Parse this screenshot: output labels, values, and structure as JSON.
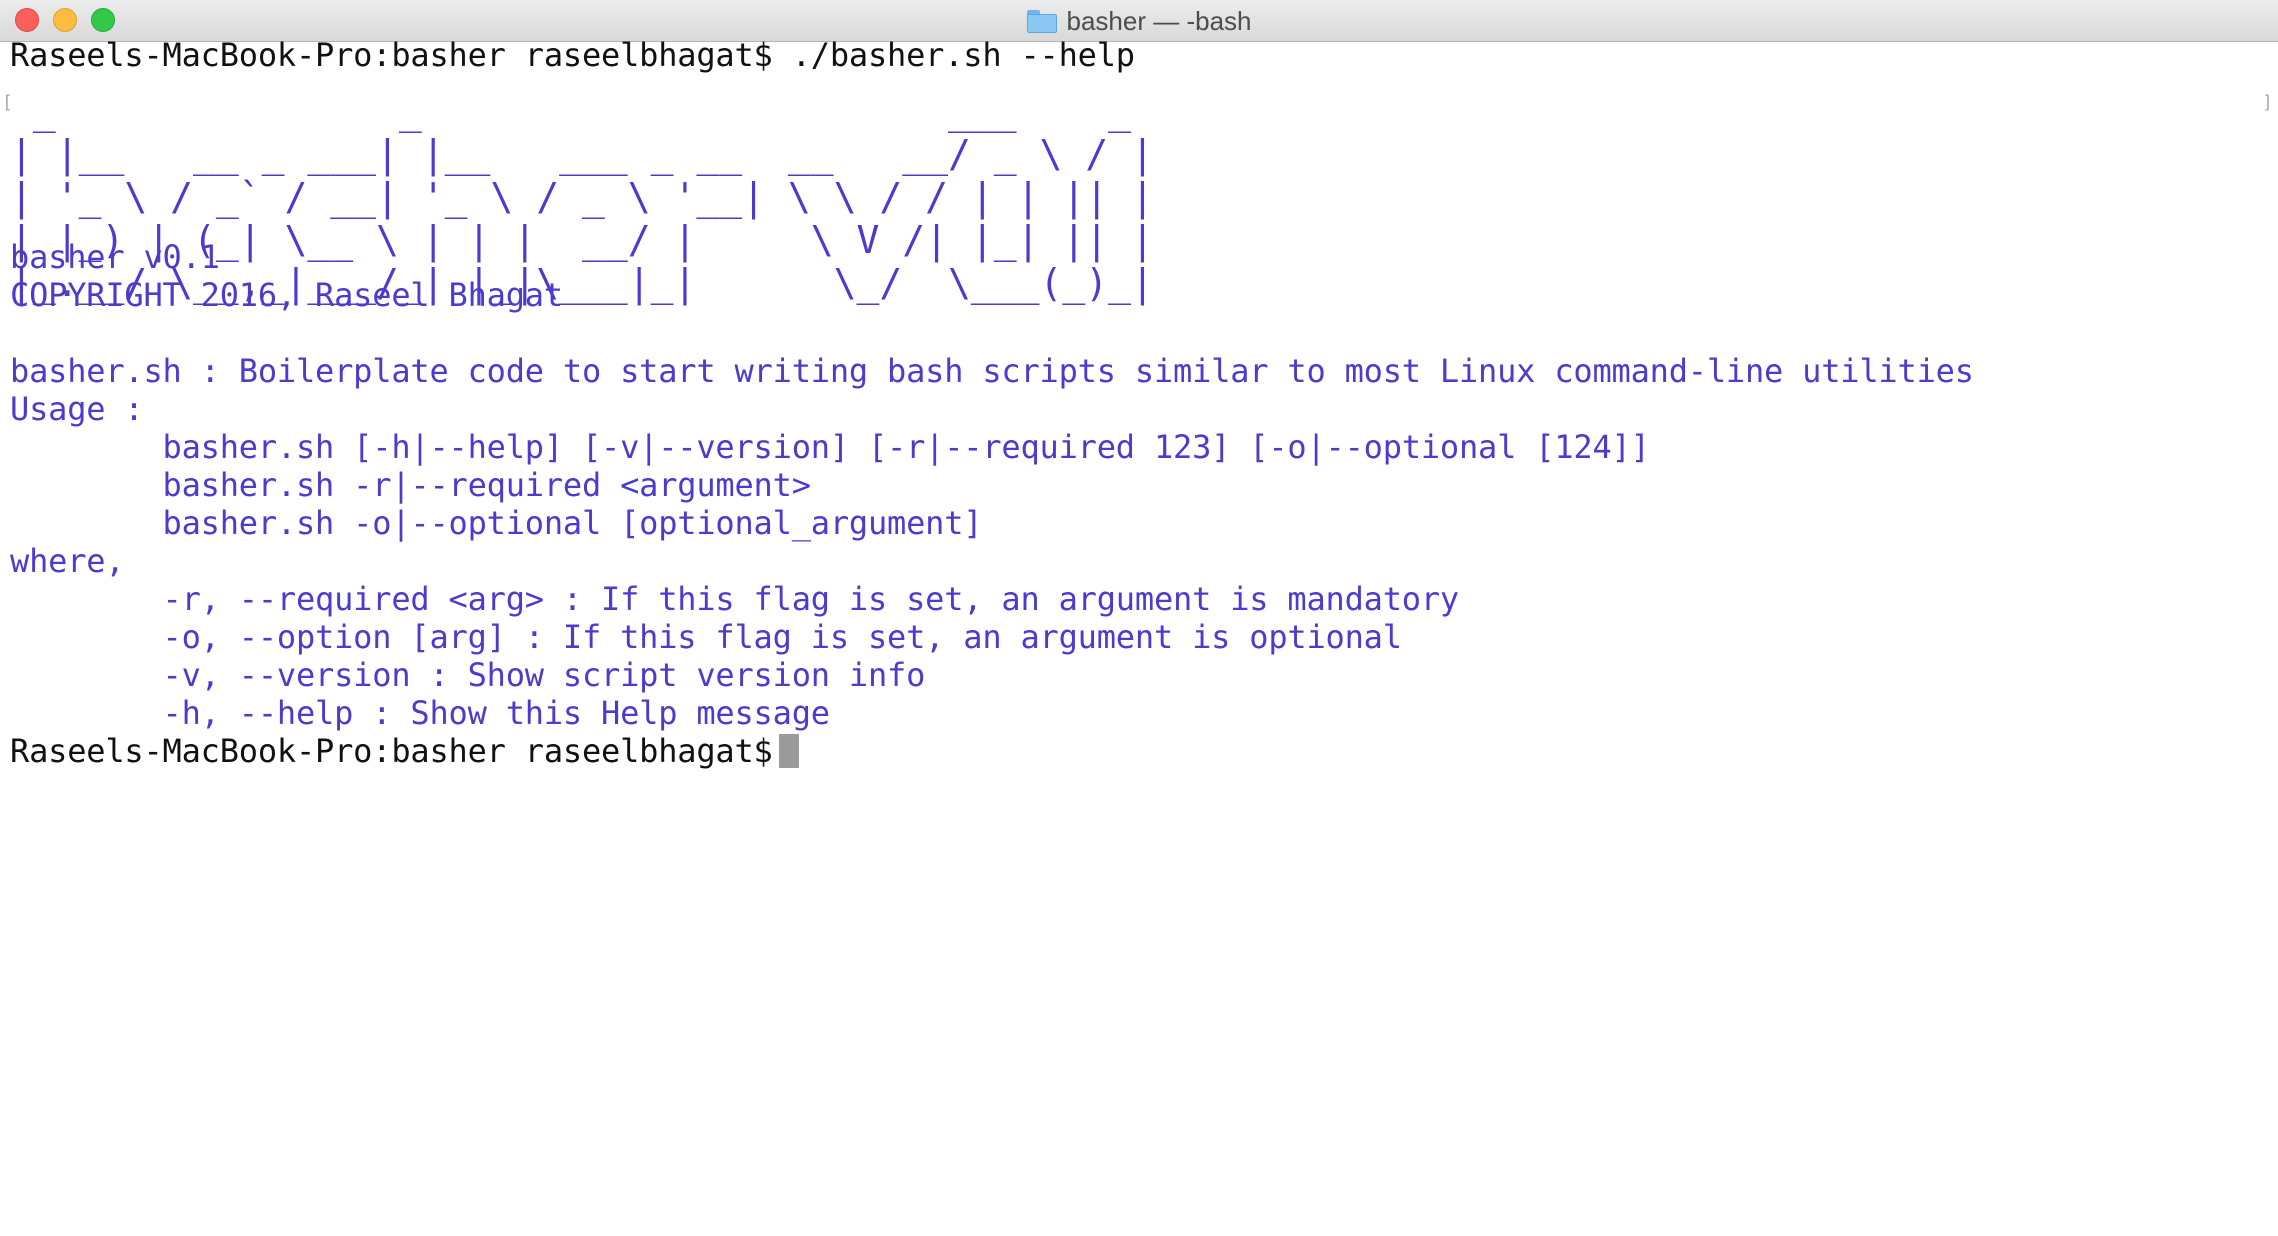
{
  "window": {
    "title": "basher — -bash",
    "folder_icon": "folder-icon"
  },
  "terminal": {
    "command_line": "Raseels-MacBook-Pro:basher raseelbhagat$ ./basher.sh --help",
    "ascii_art": " _               _                       ___    _\n| |__   __ _ ___| |__   ___ _ __  __   __/ _ \\ / |\n| '_ \\ / _` / __| '_ \\ / _ \\ '__| \\ \\ / / | | || |\n| |_) | (_| \\__ \\ | | |  __/ |     \\ V /| |_| || |\n|_.__/ \\__,_|___/_| |_|\\___|_|      \\_/  \\___(_)_|",
    "version_line": "basher v0.1",
    "copyright_line": "COPYRIGHT 2016, Raseel Bhagat",
    "description_line": "basher.sh : Boilerplate code to start writing bash scripts similar to most Linux command-line utilities",
    "usage_header": "Usage :",
    "usage_lines": [
      "        basher.sh [-h|--help] [-v|--version] [-r|--required 123] [-o|--optional [124]]",
      "        basher.sh -r|--required <argument>",
      "        basher.sh -o|--optional [optional_argument]"
    ],
    "where_header": "where,",
    "where_lines": [
      "        -r, --required <arg> : If this flag is set, an argument is mandatory",
      "        -o, --option [arg] : If this flag is set, an argument is optional",
      "        -v, --version : Show script version info",
      "        -h, --help : Show this Help message"
    ],
    "final_prompt": "Raseels-MacBook-Pro:basher raseelbhagat$",
    "colors": {
      "output": "#4b3ccf",
      "prompt": "#111111",
      "cursor": "#9b9b9b"
    }
  }
}
